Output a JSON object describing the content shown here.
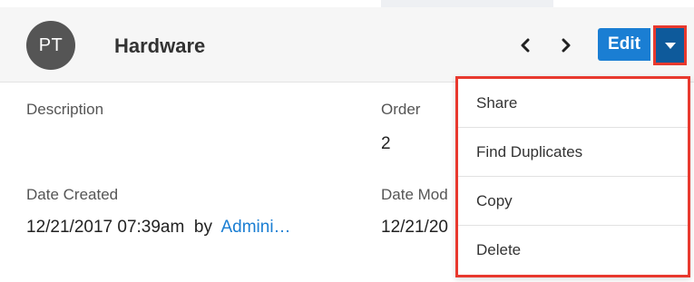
{
  "header": {
    "avatar_initials": "PT",
    "record_name": "Hardware",
    "prev_icon": "chevron-left-icon",
    "next_icon": "chevron-right-icon",
    "edit_label": "Edit",
    "actions_caret_icon": "caret-down-icon"
  },
  "fields": {
    "description": {
      "label": "Description",
      "value": ""
    },
    "order": {
      "label": "Order",
      "value": "2"
    },
    "date_created": {
      "label": "Date Created",
      "datetime": "12/21/2017 07:39am",
      "by_text": "by",
      "user": "Admini…"
    },
    "date_modified": {
      "label": "Date Mod",
      "value": "12/21/20"
    }
  },
  "actions_menu": {
    "items": [
      {
        "label": "Share"
      },
      {
        "label": "Find Duplicates"
      },
      {
        "label": "Copy"
      },
      {
        "label": "Delete"
      }
    ]
  },
  "colors": {
    "accent_blue": "#1a7ed3",
    "caret_dark_blue": "#0e5a9b",
    "highlight_red": "#e8392e",
    "avatar_gray": "#555555"
  }
}
